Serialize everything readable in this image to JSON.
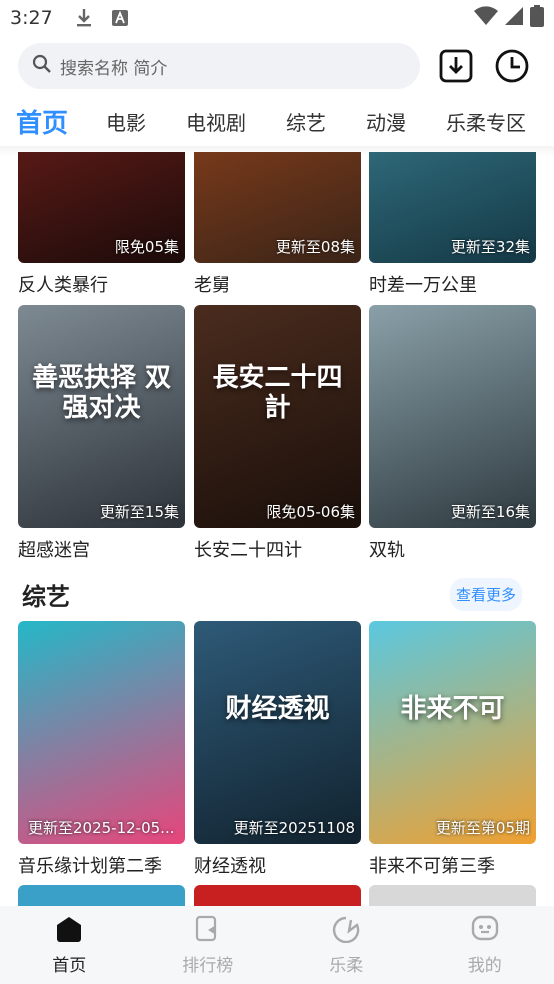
{
  "status": {
    "time": "3:27"
  },
  "search": {
    "placeholder": "搜索名称 简介"
  },
  "tabs": [
    "首页",
    "电影",
    "电视剧",
    "综艺",
    "动漫",
    "乐柔专区"
  ],
  "rows": [
    {
      "cards": [
        {
          "title": "反人类暴行",
          "badge": "限免05集",
          "colors": [
            "#5a1a16",
            "#1b0b0a"
          ]
        },
        {
          "title": "老舅",
          "badge": "更新至08集",
          "colors": [
            "#7a3a1a",
            "#3a2418"
          ]
        },
        {
          "title": "时差一万公里",
          "badge": "更新至32集",
          "colors": [
            "#2f6a7a",
            "#143845"
          ]
        }
      ]
    },
    {
      "cards": [
        {
          "title": "超感迷宫",
          "badge": "更新至15集",
          "colors": [
            "#7e8a93",
            "#2c3238"
          ],
          "art": "善恶抉择 双强对决"
        },
        {
          "title": "长安二十四计",
          "badge": "限免05-06集",
          "colors": [
            "#4a2c1e",
            "#1a0f0a"
          ],
          "art": "長安二十四計"
        },
        {
          "title": "双轨",
          "badge": "更新至16集",
          "colors": [
            "#8aa0a8",
            "#2e3a40"
          ]
        }
      ]
    }
  ],
  "section": {
    "title": "综艺",
    "more": "查看更多"
  },
  "variety": [
    {
      "title": "音乐缘计划第二季",
      "badge": "更新至2025-12-05...",
      "colors": [
        "#24b8c8",
        "#e8457a"
      ]
    },
    {
      "title": "财经透视",
      "badge": "更新至20251108",
      "colors": [
        "#2e5a78",
        "#11222e"
      ],
      "art": "财经透视"
    },
    {
      "title": "非来不可第三季",
      "badge": "更新至第05期",
      "colors": [
        "#5ac8e0",
        "#f0a030"
      ],
      "art": "非来不可"
    }
  ],
  "peek_colors": [
    "#3aa0c8",
    "#c82020",
    "#d8d8d8"
  ],
  "nav": [
    {
      "label": "首页",
      "icon": "home-icon",
      "active": true
    },
    {
      "label": "排行榜",
      "icon": "ranking-icon",
      "active": false
    },
    {
      "label": "乐柔",
      "icon": "lerou-icon",
      "active": false
    },
    {
      "label": "我的",
      "icon": "profile-icon",
      "active": false
    }
  ],
  "accent": "#2f8fff"
}
